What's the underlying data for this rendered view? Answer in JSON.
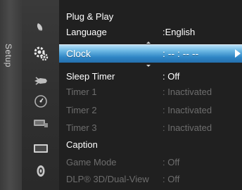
{
  "side_tab": {
    "label": "Setup"
  },
  "icons": [
    {
      "name": "picture-icon"
    },
    {
      "name": "setup-gear-icon"
    },
    {
      "name": "input-icon"
    },
    {
      "name": "application-icon"
    },
    {
      "name": "support-icon"
    },
    {
      "name": "display-icon"
    },
    {
      "name": "sound-icon"
    }
  ],
  "menu": {
    "items": [
      {
        "label": "Plug & Play",
        "value": "",
        "state": "active"
      },
      {
        "label": "Language",
        "value": ":English",
        "state": "active"
      },
      {
        "label": "Clock",
        "value": ": -- : -- --",
        "state": "selected"
      },
      {
        "label": "Sleep Timer",
        "value": ": Off",
        "state": "active"
      },
      {
        "label": "Timer 1",
        "value": ": Inactivated",
        "state": "disabled"
      },
      {
        "label": "Timer 2",
        "value": ": Inactivated",
        "state": "disabled"
      },
      {
        "label": "Timer 3",
        "value": ": Inactivated",
        "state": "disabled"
      },
      {
        "label": "Caption",
        "value": "",
        "state": "active"
      },
      {
        "label": "Game Mode",
        "value": ": Off",
        "state": "disabled"
      },
      {
        "label": "DLP® 3D/Dual-View",
        "value": ": Off",
        "state": "disabled"
      }
    ]
  }
}
